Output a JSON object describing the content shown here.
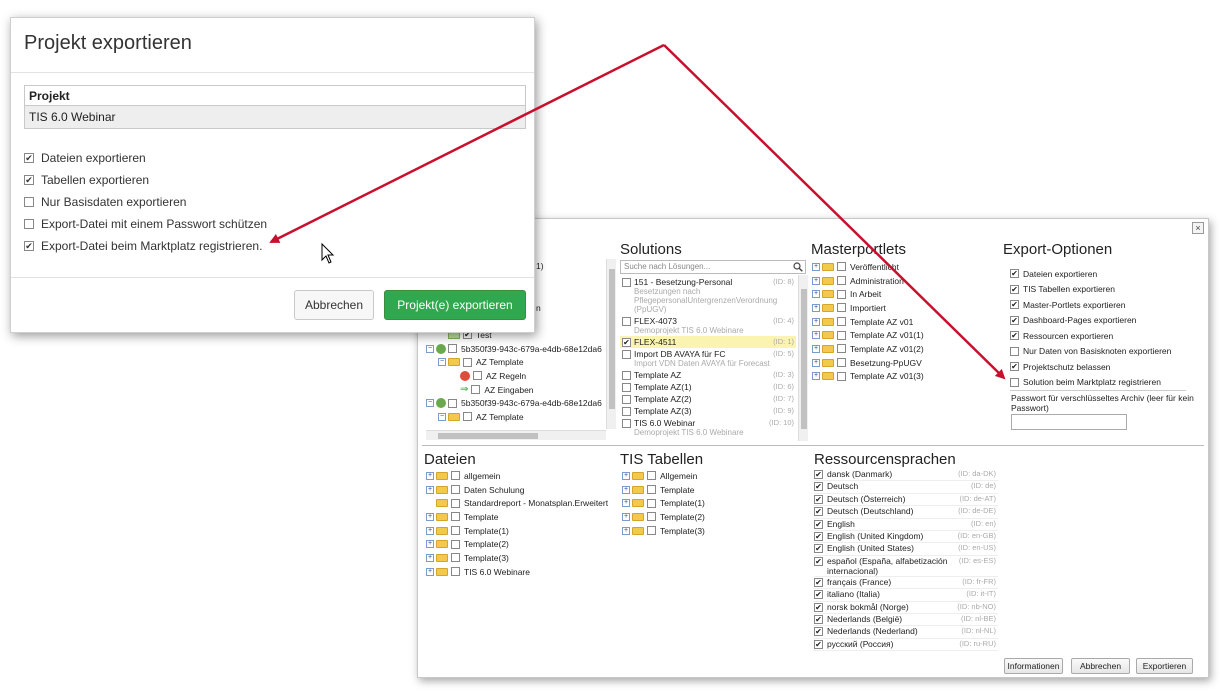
{
  "dialog": {
    "title": "Projekt exportieren",
    "project_label": "Projekt",
    "project_value": "TIS 6.0 Webinar",
    "options": [
      {
        "label": "Dateien exportieren",
        "checked": true
      },
      {
        "label": "Tabellen exportieren",
        "checked": true
      },
      {
        "label": "Nur Basisdaten exportieren",
        "checked": false
      },
      {
        "label": "Export-Datei mit einem Passwort schützen",
        "checked": false
      },
      {
        "label": "Export-Datei beim Marktplatz registrieren.",
        "checked": true
      }
    ],
    "cancel_label": "Abbrechen",
    "export_label": "Projekt(e) exportieren"
  },
  "window": {
    "close_glyph": "×",
    "left_tree": [
      {
        "label": "1)"
      },
      {
        "label": "n"
      },
      {
        "label": "Test",
        "checked": true
      },
      {
        "label": "5b350f39-943c-679a-e4db-68e12da6"
      },
      {
        "label": "AZ Template"
      },
      {
        "label": "AZ Regeln"
      },
      {
        "label": "AZ Eingaben"
      },
      {
        "label": "5b350f39-943c-679a-e4db-68e12da6"
      },
      {
        "label": "AZ Template"
      }
    ],
    "solutions": {
      "title": "Solutions",
      "search_placeholder": "Suche nach Lösungen...",
      "items": [
        {
          "name": "151 - Besetzung-Personal",
          "id": "(ID: 8)",
          "sub": "Besetzungen nach PflegepersonalUntergrenzenVerordnung (PpUGV)",
          "checked": false,
          "selected": false
        },
        {
          "name": "FLEX-4073",
          "id": "(ID: 4)",
          "sub": "Demoprojekt TIS 6.0 Webinare",
          "checked": false,
          "selected": false
        },
        {
          "name": "FLEX-4511",
          "id": "(ID: 1)",
          "sub": "",
          "checked": true,
          "selected": true
        },
        {
          "name": "Import DB AVAYA für FC",
          "id": "(ID: 5)",
          "sub": "Import VDN Daten AVAYA für Forecast",
          "checked": false,
          "selected": false
        },
        {
          "name": "Template AZ",
          "id": "(ID: 3)",
          "sub": "",
          "checked": false,
          "selected": false
        },
        {
          "name": "Template AZ(1)",
          "id": "(ID: 6)",
          "sub": "",
          "checked": false,
          "selected": false
        },
        {
          "name": "Template AZ(2)",
          "id": "(ID: 7)",
          "sub": "",
          "checked": false,
          "selected": false
        },
        {
          "name": "Template AZ(3)",
          "id": "(ID: 9)",
          "sub": "",
          "checked": false,
          "selected": false
        },
        {
          "name": "TIS 6.0 Webinar",
          "id": "(ID: 10)",
          "sub": "Demoprojekt TIS 6.0 Webinare",
          "checked": false,
          "selected": false
        }
      ]
    },
    "masterportlets": {
      "title": "Masterportlets",
      "items": [
        "Veröffentlicht",
        "Administration",
        "In Arbeit",
        "Importiert",
        "Template AZ v01",
        "Template AZ v01(1)",
        "Template AZ v01(2)",
        "Besetzung-PpUGV",
        "Template AZ v01(3)"
      ]
    },
    "export_options": {
      "title": "Export-Optionen",
      "items": [
        {
          "label": "Dateien exportieren",
          "checked": true
        },
        {
          "label": "TIS Tabellen exportieren",
          "checked": true
        },
        {
          "label": "Master-Portlets exportieren",
          "checked": true
        },
        {
          "label": "Dashboard-Pages exportieren",
          "checked": true
        },
        {
          "label": "Ressourcen exportieren",
          "checked": true
        },
        {
          "label": "Nur Daten von Basisknoten exportieren",
          "checked": false
        },
        {
          "label": "Projektschutz belassen",
          "checked": true
        },
        {
          "label": "Solution beim Marktplatz registrieren",
          "checked": false
        }
      ],
      "password_label": "Passwort für verschlüsseltes Archiv (leer für kein Passwort)"
    },
    "dateien": {
      "title": "Dateien",
      "items": [
        "allgemein",
        "Daten Schulung",
        "Standardreport - Monatsplan.Erweitert",
        "Template",
        "Template(1)",
        "Template(2)",
        "Template(3)",
        "TIS 6.0 Webinare"
      ]
    },
    "tis_tabellen": {
      "title": "TIS Tabellen",
      "items": [
        "Allgemein",
        "Template",
        "Template(1)",
        "Template(2)",
        "Template(3)"
      ]
    },
    "ressourcensprachen": {
      "title": "Ressourcensprachen",
      "items": [
        {
          "name": "dansk (Danmark)",
          "id": "(ID: da-DK)"
        },
        {
          "name": "Deutsch",
          "id": "(ID: de)"
        },
        {
          "name": "Deutsch (Österreich)",
          "id": "(ID: de-AT)"
        },
        {
          "name": "Deutsch (Deutschland)",
          "id": "(ID: de-DE)"
        },
        {
          "name": "English",
          "id": "(ID: en)"
        },
        {
          "name": "English (United Kingdom)",
          "id": "(ID: en-GB)"
        },
        {
          "name": "English (United States)",
          "id": "(ID: en-US)"
        },
        {
          "name": "español (España, alfabetización internacional)",
          "id": "(ID: es-ES)"
        },
        {
          "name": "français (France)",
          "id": "(ID: fr-FR)"
        },
        {
          "name": "italiano (Italia)",
          "id": "(ID: it-IT)"
        },
        {
          "name": "norsk bokmål (Norge)",
          "id": "(ID: nb-NO)"
        },
        {
          "name": "Nederlands (België)",
          "id": "(ID: nl-BE)"
        },
        {
          "name": "Nederlands (Nederland)",
          "id": "(ID: nl-NL)"
        },
        {
          "name": "русский (Россия)",
          "id": "(ID: ru-RU)"
        }
      ]
    },
    "buttons": {
      "info": "Informationen",
      "cancel": "Abbrechen",
      "export": "Exportieren"
    }
  },
  "colors": {
    "arrow": "#c8102e",
    "primary": "#2fa84f",
    "selected_row": "#fbf3b0"
  }
}
